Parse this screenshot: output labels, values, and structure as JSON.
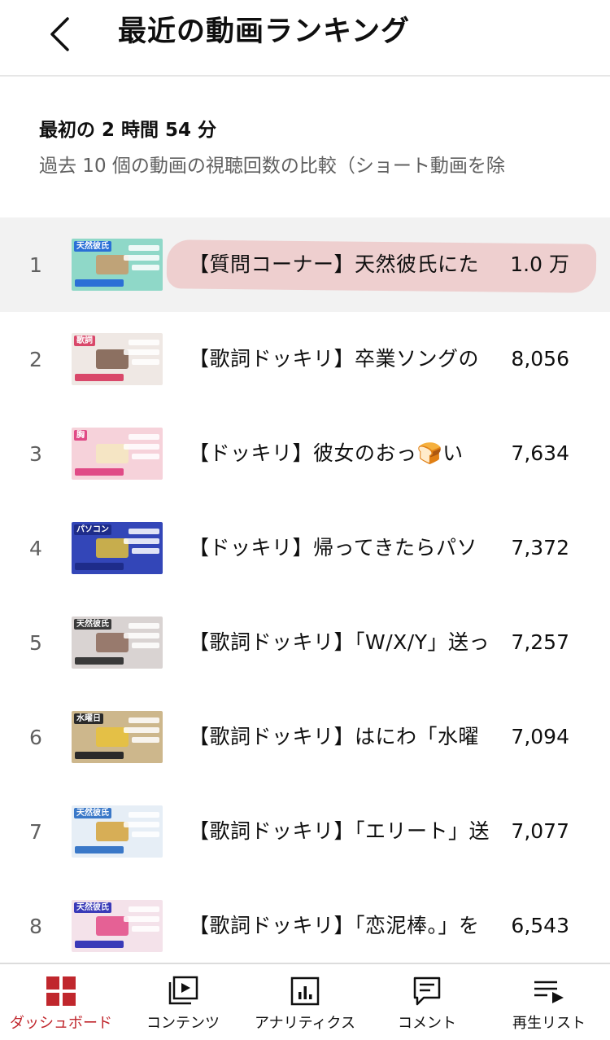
{
  "header": {
    "title": "最近の動画ランキング"
  },
  "summary": {
    "title": "最初の 2 時間 54 分",
    "subtitle": "過去 10 個の動画の視聴回数の比較（ショート動画を除"
  },
  "ranking": [
    {
      "rank": "1",
      "title": "【質問コーナー】天然彼氏にた",
      "views": "1.0 万",
      "thumb_text": "天然彼氏",
      "thumb_bg": "#8fd8c8",
      "thumb_head": "#2a6fd6",
      "thumb_accent": "#c89a6a",
      "highlight": true
    },
    {
      "rank": "2",
      "title": "【歌詞ドッキリ】卒業ソングの",
      "views": "8,056",
      "thumb_text": "歌詞",
      "thumb_bg": "#efe8e4",
      "thumb_head": "#d9486a",
      "thumb_accent": "#7a5a4a",
      "highlight": false
    },
    {
      "rank": "3",
      "title": "【ドッキリ】彼女のおっ🍞い",
      "views": "7,634",
      "thumb_text": "胸",
      "thumb_bg": "#f6d2da",
      "thumb_head": "#e04a86",
      "thumb_accent": "#f4e9c0",
      "highlight": false
    },
    {
      "rank": "4",
      "title": "【ドッキリ】帰ってきたらパソ",
      "views": "7,372",
      "thumb_text": "パソコン",
      "thumb_bg": "#3346b8",
      "thumb_head": "#1e2c8a",
      "thumb_accent": "#e2c03a",
      "highlight": false
    },
    {
      "rank": "5",
      "title": "【歌詞ドッキリ】「W/X/Y」送っ",
      "views": "7,257",
      "thumb_text": "天然彼氏",
      "thumb_bg": "#d9d3d2",
      "thumb_head": "#3a3a3a",
      "thumb_accent": "#8c6a5c",
      "highlight": false
    },
    {
      "rank": "6",
      "title": "【歌詞ドッキリ】はにわ「水曜",
      "views": "7,094",
      "thumb_text": "水曜日",
      "thumb_bg": "#cdb78c",
      "thumb_head": "#2a2a2a",
      "thumb_accent": "#e8c23a",
      "highlight": false
    },
    {
      "rank": "7",
      "title": "【歌詞ドッキリ】「エリート」送",
      "views": "7,077",
      "thumb_text": "天然彼氏",
      "thumb_bg": "#e6eef6",
      "thumb_head": "#3a78c8",
      "thumb_accent": "#d4a23a",
      "highlight": false
    },
    {
      "rank": "8",
      "title": "【歌詞ドッキリ】「恋泥棒。」を",
      "views": "6,543",
      "thumb_text": "天然彼氏",
      "thumb_bg": "#f4e2ea",
      "thumb_head": "#3a3ab8",
      "thumb_accent": "#e24a86",
      "highlight": false
    }
  ],
  "bottom_nav": [
    {
      "label": "ダッシュボード",
      "icon": "dashboard-icon",
      "active": true
    },
    {
      "label": "コンテンツ",
      "icon": "content-icon",
      "active": false
    },
    {
      "label": "アナリティクス",
      "icon": "analytics-icon",
      "active": false
    },
    {
      "label": "コメント",
      "icon": "comment-icon",
      "active": false
    },
    {
      "label": "再生リスト",
      "icon": "playlist-icon",
      "active": false
    }
  ],
  "colors": {
    "accent": "#c0272d",
    "highlight_row": "#f2f2f2",
    "marker": "#e89696",
    "secondary_text": "#606060"
  }
}
